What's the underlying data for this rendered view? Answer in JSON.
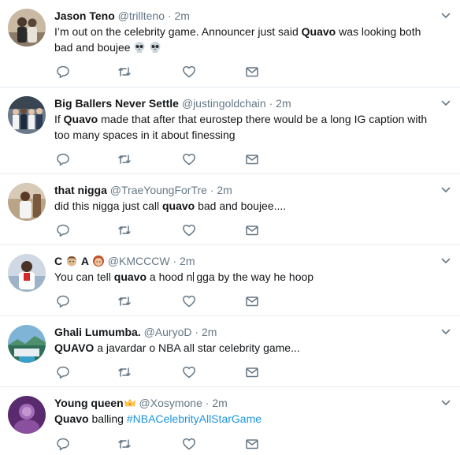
{
  "tweets": [
    {
      "name": "Jason Teno",
      "handle": "@trillteno",
      "dot": "·",
      "time": "2m",
      "parts": [
        "I’m out on the celebrity game. Announcer just said ",
        "Quavo",
        " was looking both bad and boujee "
      ],
      "emoji": "skull-skull"
    },
    {
      "name": "Big Ballers Never Settle",
      "handle": "@justingoldchain",
      "dot": "·",
      "time": "2m",
      "parts": [
        "If ",
        "Quavo",
        " made that after that eurostep there would be a long IG caption with too many spaces in it about finessing"
      ]
    },
    {
      "name": "that nigga",
      "handle": "@TraeYoungForTre",
      "dot": "·",
      "time": "2m",
      "parts": [
        "did this nigga just call ",
        "quavo",
        " bad and boujee...."
      ]
    },
    {
      "name": "C",
      "name_mid": "A",
      "handle": "@KMCCCW",
      "dot": "·",
      "time": "2m",
      "parts": [
        "You can tell ",
        "quavo",
        " a hood n",
        "gga by the way he hoop"
      ]
    },
    {
      "name": "Ghali Lumumba.",
      "handle": "@AuryoD",
      "dot": "·",
      "time": "2m",
      "parts": [
        "QUAVO",
        " a javardar o NBA all star celebrity game..."
      ]
    },
    {
      "name": "Young queen",
      "handle": "@Xosymone",
      "dot": "·",
      "time": "2m",
      "parts": [
        "Quavo",
        " balling ",
        "#NBACelebrityAllStarGame"
      ]
    }
  ],
  "icons": {
    "reply": "reply-icon",
    "retweet": "retweet-icon",
    "like": "heart-icon",
    "message": "envelope-icon",
    "more": "chevron-down-icon"
  },
  "colors": {
    "text": "#14171a",
    "secondary": "#657786",
    "hashtag": "#1b95e0",
    "divider": "#e6ecf0",
    "icon": "#657786"
  }
}
